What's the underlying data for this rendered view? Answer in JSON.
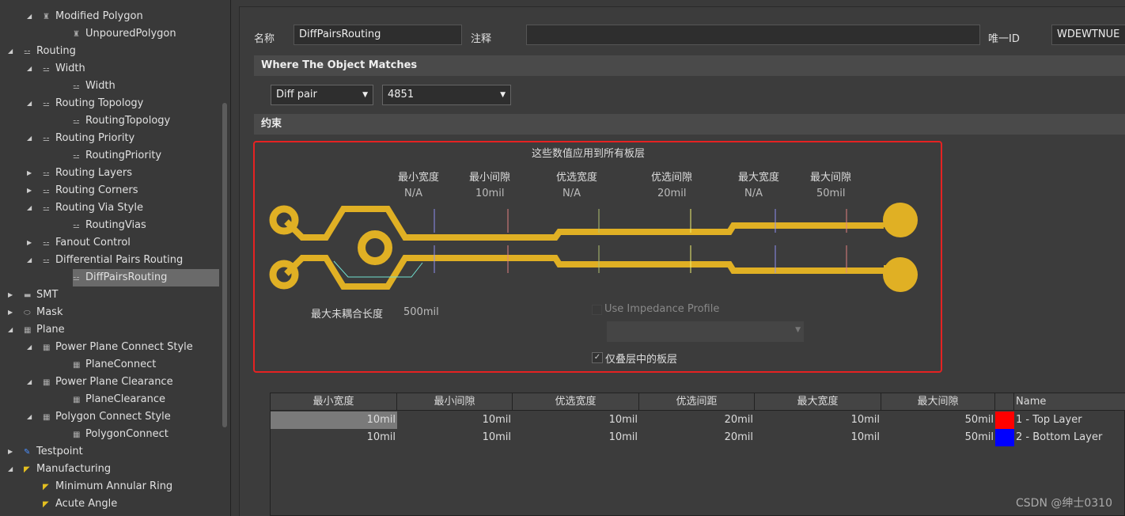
{
  "tree": [
    {
      "label": "Modified Polygon",
      "level": 1,
      "arrow": "expanded",
      "icon": "polygon-icon"
    },
    {
      "label": "UnpouredPolygon",
      "level": 2,
      "icon": "polygon-icon"
    },
    {
      "label": "Routing",
      "level": 0,
      "arrow": "expanded",
      "icon": "routing-icon"
    },
    {
      "label": "Width",
      "level": 1,
      "arrow": "expanded",
      "icon": "routing-icon"
    },
    {
      "label": "Width",
      "level": 2,
      "icon": "routing-icon"
    },
    {
      "label": "Routing Topology",
      "level": 1,
      "arrow": "expanded",
      "icon": "routing-icon"
    },
    {
      "label": "RoutingTopology",
      "level": 2,
      "icon": "routing-icon"
    },
    {
      "label": "Routing Priority",
      "level": 1,
      "arrow": "expanded",
      "icon": "routing-icon"
    },
    {
      "label": "RoutingPriority",
      "level": 2,
      "icon": "routing-icon"
    },
    {
      "label": "Routing Layers",
      "level": 1,
      "arrow": "collapsed",
      "icon": "routing-icon"
    },
    {
      "label": "Routing Corners",
      "level": 1,
      "arrow": "collapsed",
      "icon": "routing-icon"
    },
    {
      "label": "Routing Via Style",
      "level": 1,
      "arrow": "expanded",
      "icon": "routing-icon"
    },
    {
      "label": "RoutingVias",
      "level": 2,
      "icon": "routing-icon"
    },
    {
      "label": "Fanout Control",
      "level": 1,
      "arrow": "collapsed",
      "icon": "routing-icon"
    },
    {
      "label": "Differential Pairs Routing",
      "level": 1,
      "arrow": "expanded",
      "icon": "routing-icon"
    },
    {
      "label": "DiffPairsRouting",
      "level": 2,
      "icon": "routing-icon",
      "selected": true
    },
    {
      "label": "SMT",
      "level": 0,
      "arrow": "collapsed",
      "icon": "smt-icon"
    },
    {
      "label": "Mask",
      "level": 0,
      "arrow": "collapsed",
      "icon": "mask-icon"
    },
    {
      "label": "Plane",
      "level": 0,
      "arrow": "expanded",
      "icon": "plane-icon"
    },
    {
      "label": "Power Plane Connect Style",
      "level": 1,
      "arrow": "expanded",
      "icon": "plane-icon"
    },
    {
      "label": "PlaneConnect",
      "level": 2,
      "icon": "plane-icon"
    },
    {
      "label": "Power Plane Clearance",
      "level": 1,
      "arrow": "expanded",
      "icon": "plane-icon"
    },
    {
      "label": "PlaneClearance",
      "level": 2,
      "icon": "plane-icon"
    },
    {
      "label": "Polygon Connect Style",
      "level": 1,
      "arrow": "expanded",
      "icon": "plane-icon"
    },
    {
      "label": "PolygonConnect",
      "level": 2,
      "icon": "plane-icon"
    },
    {
      "label": "Testpoint",
      "level": 0,
      "arrow": "collapsed",
      "icon": "testpoint-icon"
    },
    {
      "label": "Manufacturing",
      "level": 0,
      "arrow": "expanded",
      "icon": "manufacturing-icon"
    },
    {
      "label": "Minimum Annular Ring",
      "level": 1,
      "icon": "manufacturing-icon"
    },
    {
      "label": "Acute Angle",
      "level": 1,
      "icon": "manufacturing-icon"
    }
  ],
  "form": {
    "name_label": "名称",
    "name_value": "DiffPairsRouting",
    "comment_label": "注释",
    "comment_value": "",
    "uid_label": "唯一ID",
    "uid_value": "WDEWTNUE"
  },
  "match": {
    "title": "Where The Object Matches",
    "type": "Diff pair",
    "net": "4851"
  },
  "constraints": {
    "title": "约束",
    "applies": "这些数值应用到所有板层",
    "params": [
      {
        "label": "最小宽度",
        "value": "N/A"
      },
      {
        "label": "最小间隙",
        "value": "10mil"
      },
      {
        "label": "优选宽度",
        "value": "N/A"
      },
      {
        "label": "优选间隙",
        "value": "20mil"
      },
      {
        "label": "最大宽度",
        "value": "N/A"
      },
      {
        "label": "最大间隙",
        "value": "50mil"
      }
    ],
    "uncoupled_label": "最大未耦合长度",
    "uncoupled_value": "500mil",
    "impedance_label": "Use Impedance Profile",
    "impedance_checked": false,
    "stack_label": "仅叠层中的板层",
    "stack_checked": true,
    "trace_color": "#e0b024"
  },
  "table": {
    "headers": [
      "最小宽度",
      "最小间隙",
      "优选宽度",
      "优选间距",
      "最大宽度",
      "最大间隙",
      "",
      "Name"
    ],
    "rows": [
      {
        "cells": [
          "10mil",
          "10mil",
          "10mil",
          "20mil",
          "10mil",
          "50mil"
        ],
        "color": "#ff0000",
        "name": "1 - Top Layer"
      },
      {
        "cells": [
          "10mil",
          "10mil",
          "10mil",
          "20mil",
          "10mil",
          "50mil"
        ],
        "color": "#0000ff",
        "name": "2 - Bottom Layer"
      }
    ]
  },
  "watermark": "CSDN @绅士0310"
}
